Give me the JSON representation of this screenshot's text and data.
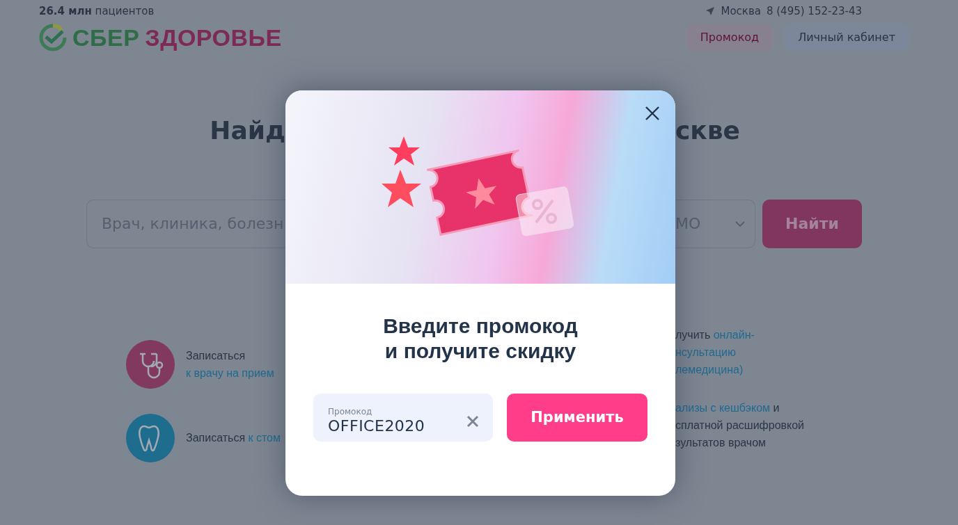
{
  "header": {
    "patients": "**26.4 млн** пациентов",
    "city": "Москва",
    "phone": "8 (495) 152-23-43",
    "logo": {
      "part_1": "СБЕР",
      "part_2": "ЗДОРОВЬЕ"
    },
    "buttons": [
      {
        "kind": "promo",
        "label": "Промокод"
      },
      {
        "kind": "account",
        "label": "Личный кабинет"
      }
    ]
  },
  "hero": {
    "title_left": "Найд",
    "title_right": "скве"
  },
  "search": {
    "placeholder": "Врач, клиника, болезн",
    "select_value": "МО",
    "button": "Найти"
  },
  "features_left": [
    {
      "kind": "doctor",
      "lines": [
        [
          {
            "text": "Записаться",
            "link": false
          }
        ],
        [
          {
            "text": "к врачу на прием",
            "link": true
          }
        ]
      ]
    },
    {
      "kind": "tooth",
      "lines": [
        [
          {
            "text": "Записаться ",
            "link": false
          },
          {
            "text": "к стом",
            "link": true
          }
        ]
      ]
    }
  ],
  "features_right": [
    {
      "lines": [
        [
          {
            "text": "лучить ",
            "link": false
          },
          {
            "text": "онлайн-",
            "link": true
          }
        ],
        [
          {
            "text": "нсультацию",
            "link": true
          }
        ],
        [
          {
            "text": "лемедицина)",
            "link": true
          }
        ]
      ]
    },
    {
      "lines": [
        [
          {
            "text": "ализы с кешбэком",
            "link": true
          },
          {
            "text": " и",
            "link": false
          }
        ],
        [
          {
            "text": "сплатной расшифровкой",
            "link": false
          }
        ],
        [
          {
            "text": "зультатов врачом",
            "link": false
          }
        ]
      ]
    }
  ],
  "modal": {
    "title_lines": [
      "Введите промокод",
      "и получите скидку"
    ],
    "promo_field": {
      "label": "Промокод",
      "value": "OFFICE2020"
    },
    "apply_button": "Применить"
  }
}
